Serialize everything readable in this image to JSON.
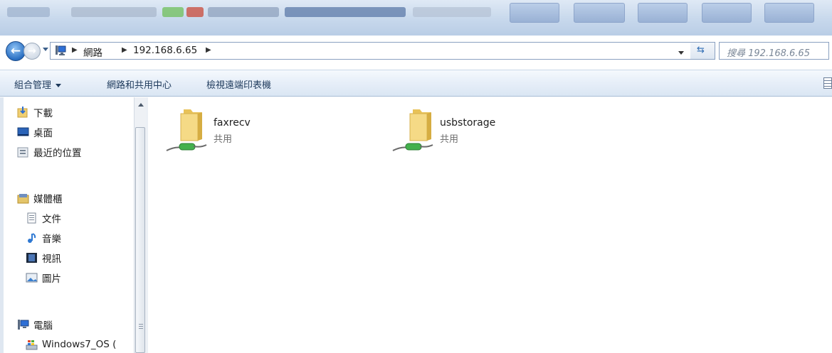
{
  "address": {
    "crumbs": [
      "網路",
      "192.168.6.65"
    ],
    "search_placeholder": "搜尋 192.168.6.65"
  },
  "toolbar": {
    "organize": "組合管理",
    "network_center": "網路和共用中心",
    "view_printers": "檢視遠端印表機"
  },
  "nav": {
    "favorites": [
      "下載",
      "桌面",
      "最近的位置"
    ],
    "libraries": {
      "label": "媒體櫃",
      "items": [
        "文件",
        "音樂",
        "視訊",
        "圖片"
      ]
    },
    "computer": {
      "label": "電腦",
      "items": [
        "Windows7_OS ("
      ]
    }
  },
  "shares": [
    {
      "name": "faxrecv",
      "type": "共用"
    },
    {
      "name": "usbstorage",
      "type": "共用"
    }
  ],
  "colors": {
    "accent": "#2a6fc2",
    "folder": "#f2d27a",
    "cable": "#3fae49"
  }
}
